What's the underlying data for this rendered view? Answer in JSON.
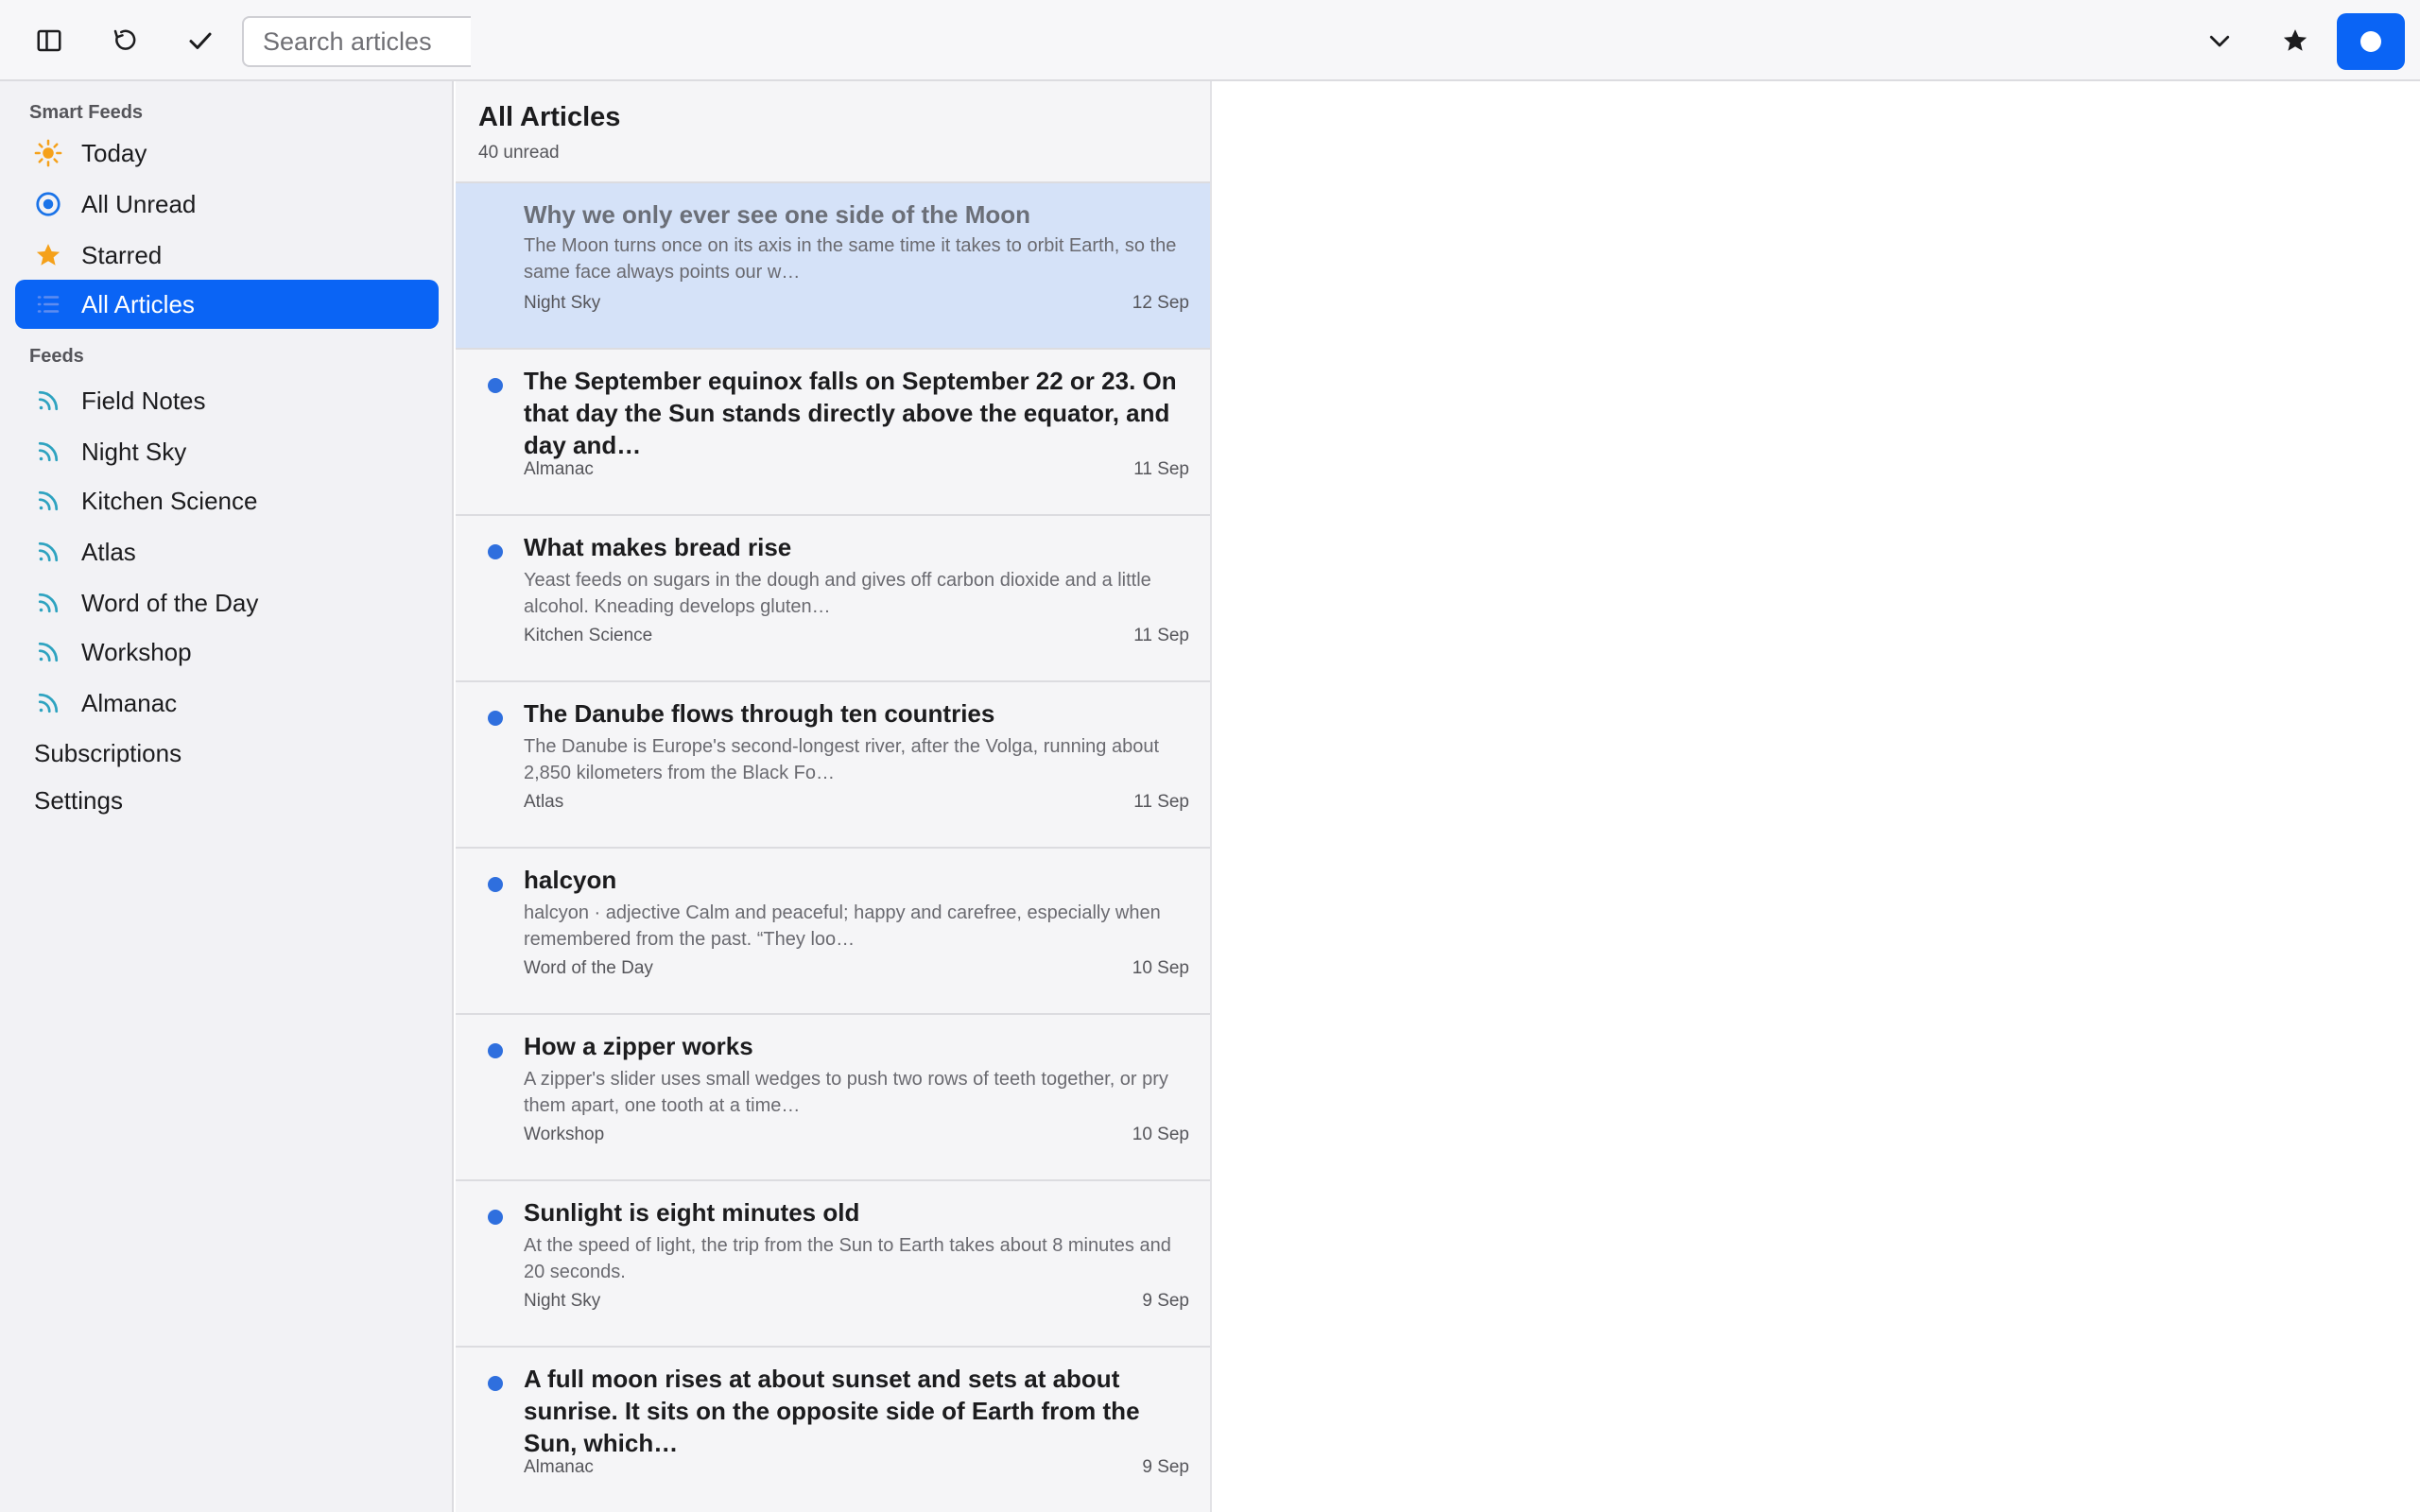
{
  "toolbar": {
    "search_placeholder": "Search articles",
    "icons": [
      "sidebar-toggle-icon",
      "refresh-icon",
      "checkmark-icon",
      "chevron-down-icon",
      "star-icon",
      "record-dot-icon"
    ],
    "accent_color": "#0a64f5"
  },
  "sidebar": {
    "smart_feeds_label": "Smart Feeds",
    "smart_feeds": [
      {
        "label": "Today",
        "icon": "sun-icon"
      },
      {
        "label": "All Unread",
        "icon": "unread-circle-icon"
      },
      {
        "label": "Starred",
        "icon": "star-icon"
      },
      {
        "label": "All Articles",
        "icon": "list-icon",
        "active": true
      }
    ],
    "feeds_label": "Feeds",
    "feeds": [
      {
        "label": "Field Notes",
        "icon": "rss-icon"
      },
      {
        "label": "Night Sky",
        "icon": "rss-icon"
      },
      {
        "label": "Kitchen Science",
        "icon": "rss-icon"
      },
      {
        "label": "Atlas",
        "icon": "rss-icon"
      },
      {
        "label": "Word of the Day",
        "icon": "rss-icon"
      },
      {
        "label": "Workshop",
        "icon": "rss-icon"
      },
      {
        "label": "Almanac",
        "icon": "rss-icon"
      }
    ],
    "subscriptions_label": "Subscriptions",
    "settings_label": "Settings"
  },
  "list": {
    "title": "All Articles",
    "subtitle": "40 unread",
    "articles": [
      {
        "title": "Why we only ever see one side of the Moon",
        "excerpt": "The Moon turns once on its axis in the same time it takes to orbit Earth, so the same face always points our w…",
        "feed": "Night Sky",
        "date": "12 Sep",
        "unread": false,
        "selected": true
      },
      {
        "title": "The September equinox falls on September 22 or 23. On that day the Sun stands directly above the equator, and day and…",
        "excerpt": "",
        "feed": "Almanac",
        "date": "11 Sep",
        "unread": true
      },
      {
        "title": "What makes bread rise",
        "excerpt": "Yeast feeds on sugars in the dough and gives off carbon dioxide and a little alcohol. Kneading develops gluten…",
        "feed": "Kitchen Science",
        "date": "11 Sep",
        "unread": true
      },
      {
        "title": "The Danube flows through ten countries",
        "excerpt": "The Danube is Europe's second-longest river, after the Volga, running about 2,850 kilometers from the Black Fo…",
        "feed": "Atlas",
        "date": "11 Sep",
        "unread": true
      },
      {
        "title": "halcyon",
        "excerpt": "halcyon · adjective Calm and peaceful; happy and carefree, especially when remembered from the past. “They loo…",
        "feed": "Word of the Day",
        "date": "10 Sep",
        "unread": true
      },
      {
        "title": "How a zipper works",
        "excerpt": "A zipper's slider uses small wedges to push two rows of teeth together, or pry them apart, one tooth at a time…",
        "feed": "Workshop",
        "date": "10 Sep",
        "unread": true
      },
      {
        "title": "Sunlight is eight minutes old",
        "excerpt": "At the speed of light, the trip from the Sun to Earth takes about 8 minutes and 20 seconds.",
        "feed": "Night Sky",
        "date": "9 Sep",
        "unread": true
      },
      {
        "title": "A full moon rises at about sunset and sets at about sunrise. It sits on the opposite side of Earth from the Sun, which…",
        "excerpt": "",
        "feed": "Almanac",
        "date": "9 Sep",
        "unread": true
      }
    ]
  }
}
